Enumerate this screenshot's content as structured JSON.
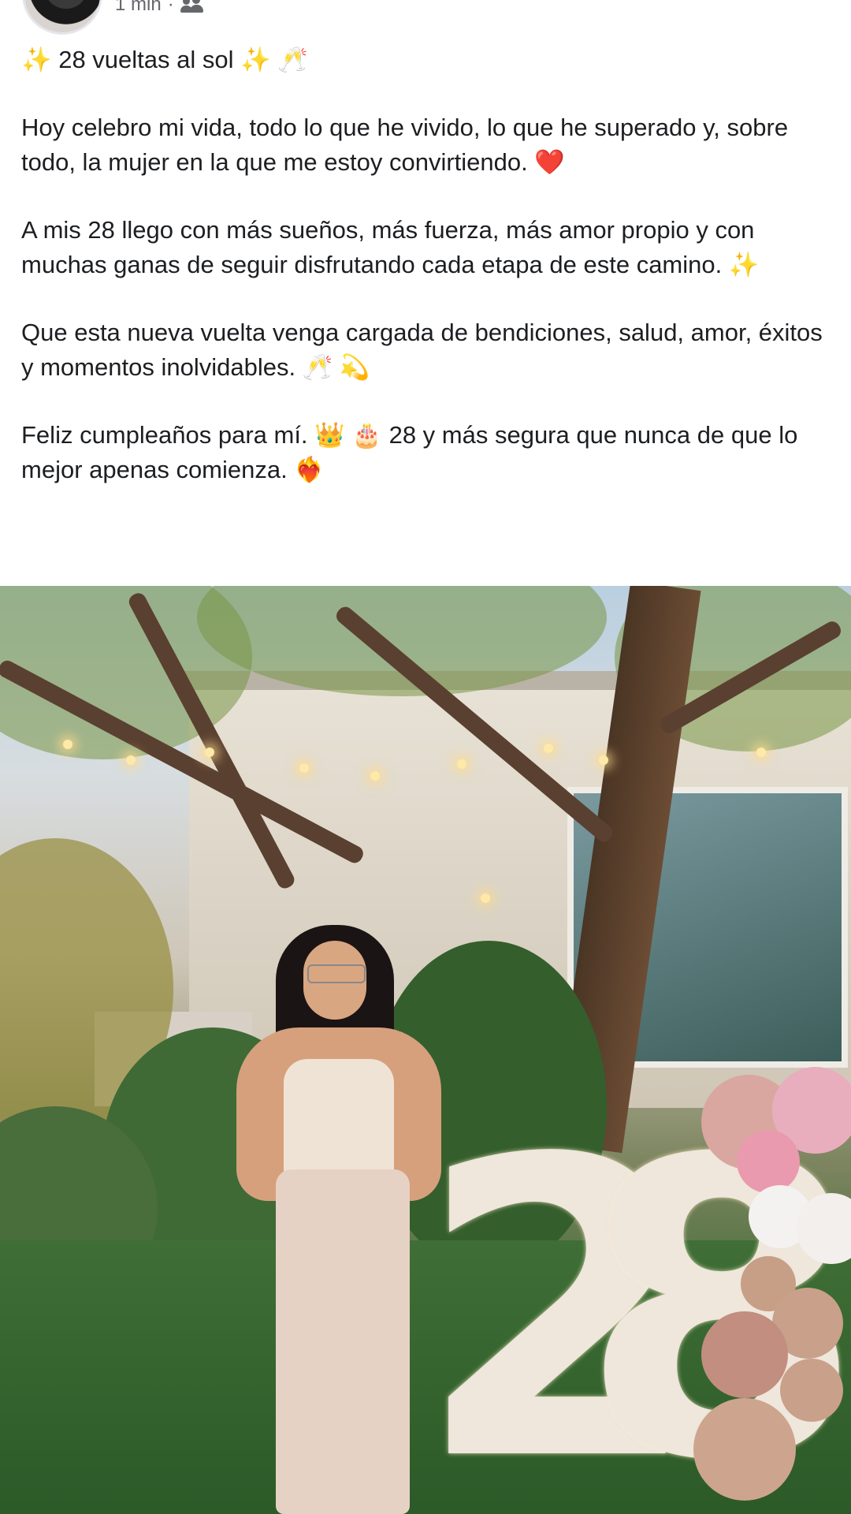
{
  "post": {
    "time": "1 min",
    "separator": "·",
    "audience_icon": "friends-icon",
    "paragraphs": [
      "✨ 28 vueltas al sol ✨ 🥂",
      "Hoy celebro mi vida, todo lo que he vivido, lo que he superado y, sobre todo, la mujer en la que me estoy convirtiendo. ❤️",
      "A mis 28 llego con más sueños, más fuerza, más amor propio y con muchas ganas de seguir disfrutando cada etapa de este camino. ✨",
      "Que esta nueva vuelta venga cargada de bendiciones, salud, amor, éxitos y momentos inolvidables. 🥂 💫",
      "Feliz cumpleaños para mí. 👑 🎂 28 y más segura que nunca de que lo mejor apenas comienza. ❤️‍🔥"
    ]
  },
  "photo": {
    "marquee_digits": [
      "2",
      "8"
    ]
  }
}
